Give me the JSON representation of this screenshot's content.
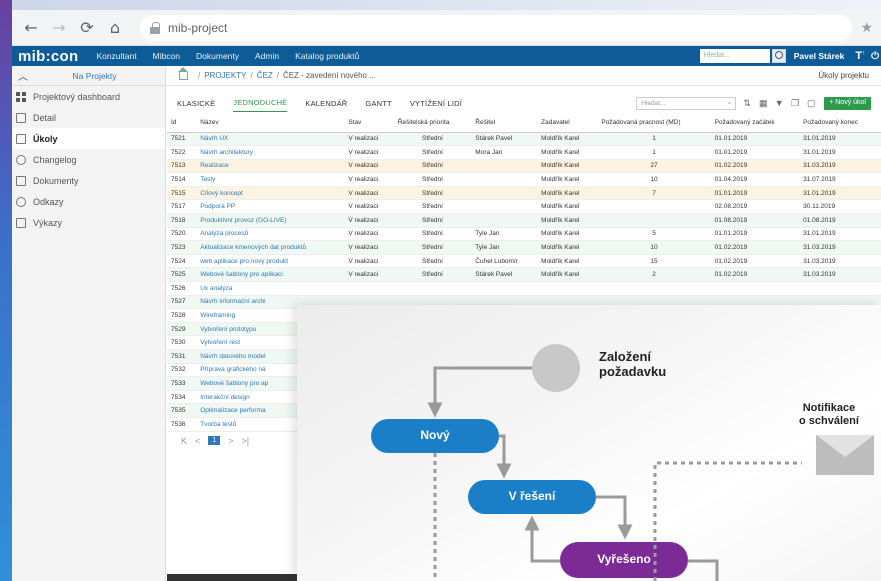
{
  "browser": {
    "url": "mib-project"
  },
  "app": {
    "logo": "mib:con",
    "nav": [
      "Konzultant",
      "Mibcon",
      "Dokumenty",
      "Admin",
      "Katalog produktů"
    ],
    "search_placeholder": "Hledat...",
    "user": "Pavel Stárek",
    "t_icon": "T",
    "t_icon_sup": "↑"
  },
  "sidebar": {
    "back_label": "Na Projekty",
    "items": [
      {
        "label": "Projektový dashboard",
        "icon": "dashboard-icon"
      },
      {
        "label": "Detail",
        "icon": "detail-icon"
      },
      {
        "label": "Úkoly",
        "icon": "tasks-icon",
        "active": true
      },
      {
        "label": "Changelog",
        "icon": "clock-icon"
      },
      {
        "label": "Dokumenty",
        "icon": "documents-icon"
      },
      {
        "label": "Odkazy",
        "icon": "link-icon"
      },
      {
        "label": "Výkazy",
        "icon": "report-icon"
      }
    ]
  },
  "breadcrumb": {
    "items": [
      "PROJEKTY",
      "ČEZ",
      "ČEZ - zavedení nového ..."
    ],
    "right": "Úkoly projektu"
  },
  "tabs": {
    "items": [
      "KLASICKÉ",
      "JEDNODUCHÉ",
      "KALENDÁŘ",
      "GANTT",
      "VYTÍŽENÍ LIDÍ"
    ],
    "active": "JEDNODUCHÉ",
    "search_placeholder": "Hledat...",
    "new_button": "+ Nový úkol"
  },
  "table": {
    "headers": [
      "Id",
      "Název",
      "Stav",
      "Řešitelská priorita",
      "Řešitel",
      "Zadavatel",
      "Požadovaná pracnost (MD)",
      "Požadovaný začátek",
      "Požadovaný konec"
    ],
    "rows": [
      [
        "7521",
        "Návrh UX",
        "V realizaci",
        "Střední",
        "Stárek Pavel",
        "Moldřík Karel",
        "1",
        "01.01.2019",
        "31.01.2019"
      ],
      [
        "7522",
        "Návrh architektury",
        "V realizaci",
        "Střední",
        "Mora Jan",
        "Moldřík Karel",
        "1",
        "01.01.2019",
        "31.01.2019"
      ],
      [
        "7513",
        "Realizace",
        "V realizaci",
        "Střední",
        "",
        "Moldřík Karel",
        "27",
        "01.02.2019",
        "31.03.2019"
      ],
      [
        "7514",
        "Testy",
        "V realizaci",
        "Střední",
        "",
        "Moldřík Karel",
        "10",
        "01.04.2019",
        "31.07.2019"
      ],
      [
        "7515",
        "Cílový koncept",
        "V realizaci",
        "Střední",
        "",
        "Moldřík Karel",
        "7",
        "01.01.2019",
        "31.01.2019"
      ],
      [
        "7517",
        "Podpora PP",
        "V realizaci",
        "Střední",
        "",
        "Moldřík Karel",
        "",
        "02.08.2019",
        "30.11.2019"
      ],
      [
        "7518",
        "Produktivní provoz (GO-LIVE)",
        "V realizaci",
        "Střední",
        "",
        "Moldřík Karel",
        "",
        "01.08.2019",
        "01.08.2019"
      ],
      [
        "7520",
        "Analýza procesů",
        "V realizaci",
        "Střední",
        "Tyle Jan",
        "Moldřík Karel",
        "5",
        "01.01.2019",
        "31.01.2019"
      ],
      [
        "7523",
        "Aktualizace kmenových dat produktů",
        "V realizaci",
        "Střední",
        "Tyle Jan",
        "Moldřík Karel",
        "10",
        "01.02.2019",
        "31.03.2019"
      ],
      [
        "7524",
        "web aplikace pro nový produkt",
        "V realizaci",
        "Střední",
        "Čuhel Lubomír",
        "Moldřík Karel",
        "15",
        "01.02.2019",
        "31.03.2019"
      ],
      [
        "7525",
        "Webové šablony pro aplikaci",
        "V realizaci",
        "Střední",
        "Stárek Pavel",
        "Moldřík Karel",
        "2",
        "01.02.2019",
        "31.03.2019"
      ],
      [
        "7526",
        "Ux analýza",
        "",
        "",
        "",
        "",
        "",
        "",
        ""
      ],
      [
        "7527",
        "Návrh informační archi",
        "",
        "",
        "",
        "",
        "",
        "",
        ""
      ],
      [
        "7528",
        "Wireframing",
        "",
        "",
        "",
        "",
        "",
        "",
        ""
      ],
      [
        "7529",
        "Vytvoření prototypu",
        "",
        "",
        "",
        "",
        "",
        "",
        ""
      ],
      [
        "7530",
        "Vytvoření rest",
        "",
        "",
        "",
        "",
        "",
        "",
        ""
      ],
      [
        "7531",
        "Návrh datového model",
        "",
        "",
        "",
        "",
        "",
        "",
        ""
      ],
      [
        "7532",
        "Příprava grafického ná",
        "",
        "",
        "",
        "",
        "",
        "",
        ""
      ],
      [
        "7533",
        "Webové šablony pro ap",
        "",
        "",
        "",
        "",
        "",
        "",
        ""
      ],
      [
        "7534",
        "Interakční design",
        "",
        "",
        "",
        "",
        "",
        "",
        ""
      ],
      [
        "7535",
        "Optimalizace performa",
        "",
        "",
        "",
        "",
        "",
        "",
        ""
      ],
      [
        "7536",
        "Tvorba testů",
        "",
        "",
        "",
        "",
        "",
        "",
        ""
      ]
    ],
    "highlight_ids": [
      "7513",
      "7515"
    ]
  },
  "pager": {
    "first": "K",
    "prev": "<",
    "current": "1",
    "next": ">",
    "last": ">|"
  },
  "workflow": {
    "start_label_line1": "Založení",
    "start_label_line2": "požadavku",
    "notif_line1": "Notifikace",
    "notif_line2": "o schválení",
    "steps": [
      "Nový",
      "V řešení",
      "Vyřešeno"
    ]
  },
  "colors": {
    "brand": "#0e5c97",
    "accent_green": "#2e9a4b",
    "step_blue": "#1a7fc6",
    "step_purple": "#7b2a96"
  }
}
